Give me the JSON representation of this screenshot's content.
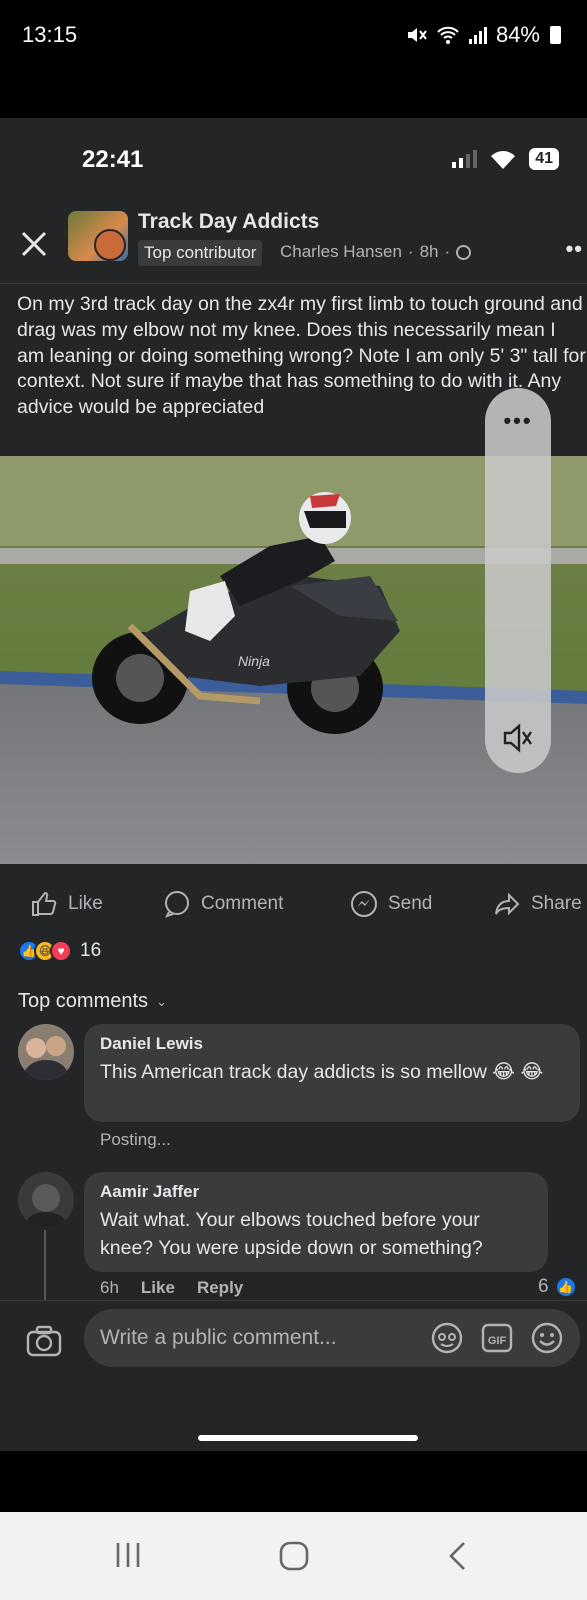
{
  "outer_status": {
    "time": "13:15",
    "battery": "84%",
    "icons": [
      "mute-icon",
      "wifi-icon",
      "signal-icon",
      "battery-icon"
    ]
  },
  "inner_status": {
    "time": "22:41",
    "battery": "41"
  },
  "post": {
    "group_name": "Track Day Addicts",
    "badge": "Top contributor",
    "author": "Charles Hansen",
    "time": "8h",
    "text": "On my 3rd track day on the zx4r my first limb to touch ground and drag was my elbow not my knee. Does this necessarily mean I am leaning or doing something wrong? Note I am only 5' 3\" tall for context. Not sure if maybe that has something to do with it. Any advice would be appreciated",
    "bike_brand": "Ninja"
  },
  "actions": {
    "like": "Like",
    "comment": "Comment",
    "send": "Send",
    "share": "Share"
  },
  "reactions": {
    "count": "16"
  },
  "comments_header": "Top comments",
  "comments": [
    {
      "name": "Daniel Lewis",
      "text": "This American track day addicts is so mellow 😂 😂",
      "status": "Posting..."
    },
    {
      "name": "Aamir Jaffer",
      "text": "Wait what. Your elbows touched before your knee? You were upside down or something?",
      "time": "6h",
      "like": "Like",
      "reply": "Reply",
      "reaction_count": "6"
    }
  ],
  "composer": {
    "placeholder": "Write a public comment..."
  },
  "colors": {
    "background": "#242526",
    "bubble": "#3a3b3c",
    "like_blue": "#1877f2"
  }
}
